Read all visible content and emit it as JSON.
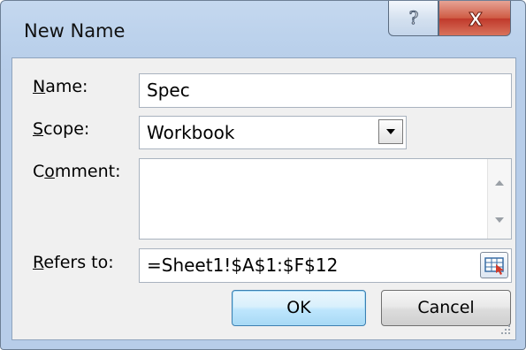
{
  "window": {
    "title": "New Name",
    "help_glyph": "?",
    "close_glyph": "X"
  },
  "form": {
    "name_label_u": "N",
    "name_label_rest": "ame:",
    "name_value": "Spec",
    "scope_label_u": "S",
    "scope_label_rest": "cope:",
    "scope_value": "Workbook",
    "comment_label_pre": "C",
    "comment_label_u": "o",
    "comment_label_rest": "mment:",
    "comment_value": "",
    "refers_label_u": "R",
    "refers_label_rest": "efers to:",
    "refers_value": "=Sheet1!$A$1:$F$12"
  },
  "buttons": {
    "ok": "OK",
    "cancel": "Cancel"
  },
  "icons": {
    "help": "help-icon",
    "close": "close-icon",
    "dropdown": "chevron-down-icon",
    "scroll_up": "scroll-up-arrow-icon",
    "scroll_down": "scroll-down-arrow-icon",
    "range_select": "range-select-icon",
    "resize": "resize-grip-icon"
  },
  "colors": {
    "title_bar": "#bcd2ec",
    "close_button": "#c0392b",
    "default_button_border": "#3c7fb1",
    "dialog_body": "#f0f0f0"
  }
}
